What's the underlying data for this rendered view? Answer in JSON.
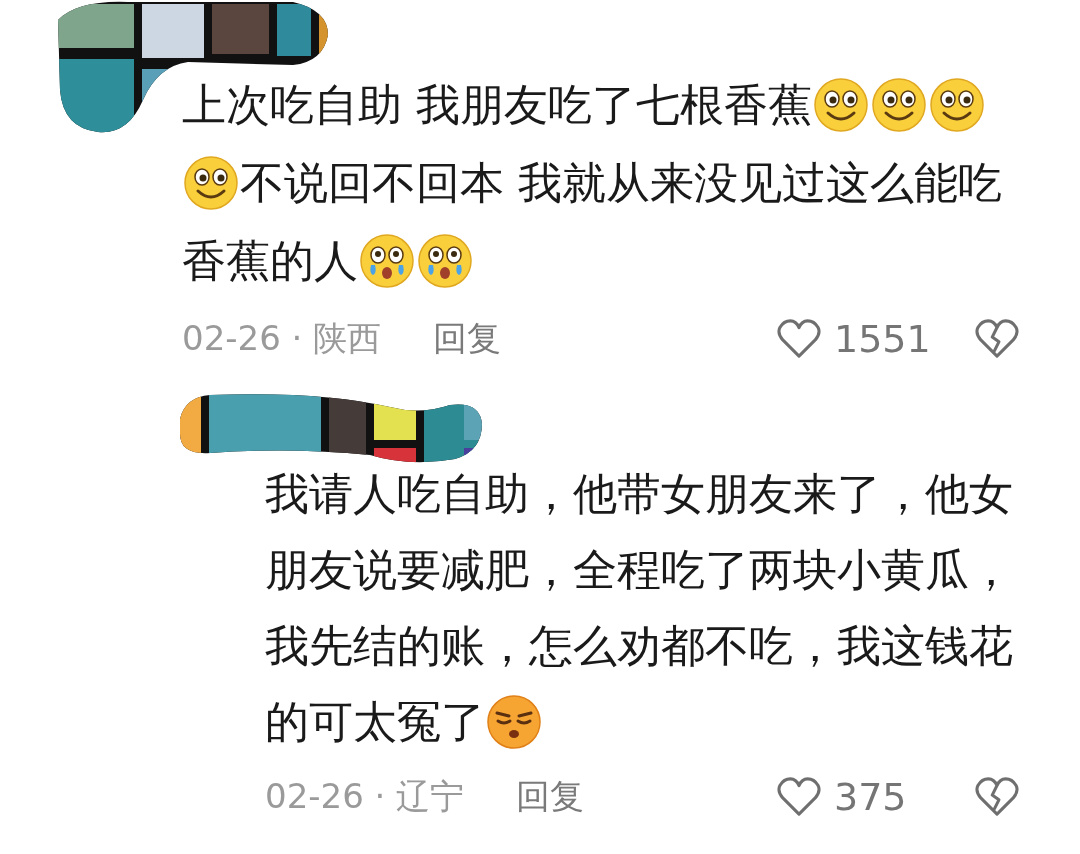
{
  "comments": [
    {
      "lines": [
        [
          {
            "kind": "text",
            "text": "上次吃自助 我朋友吃了七根香蕉"
          },
          {
            "kind": "smile"
          },
          {
            "kind": "smile"
          },
          {
            "kind": "smile"
          }
        ],
        [
          {
            "kind": "smile"
          },
          {
            "kind": "text",
            "text": "不说回不回本 我就从来没见过这么能吃"
          }
        ],
        [
          {
            "kind": "text",
            "text": "香蕉的人"
          },
          {
            "kind": "tearful"
          },
          {
            "kind": "tearful"
          }
        ]
      ],
      "date": "02-26 · 陕西",
      "reply": "回复",
      "likes": "1551",
      "kind": "comment"
    },
    {
      "lines": [
        [
          {
            "kind": "text",
            "text": "我请人吃自助，他带女朋友来了，他女"
          }
        ],
        [
          {
            "kind": "text",
            "text": "朋友说要减肥，全程吃了两块小黄瓜，"
          }
        ],
        [
          {
            "kind": "text",
            "text": "我先结的账，怎么劝都不吃，我这钱花"
          }
        ],
        [
          {
            "kind": "text",
            "text": "的可太冤了"
          },
          {
            "kind": "grumpy"
          }
        ]
      ],
      "date": "02-26 · 辽宁",
      "reply": "回复",
      "likes": "375",
      "kind": "reply"
    }
  ]
}
